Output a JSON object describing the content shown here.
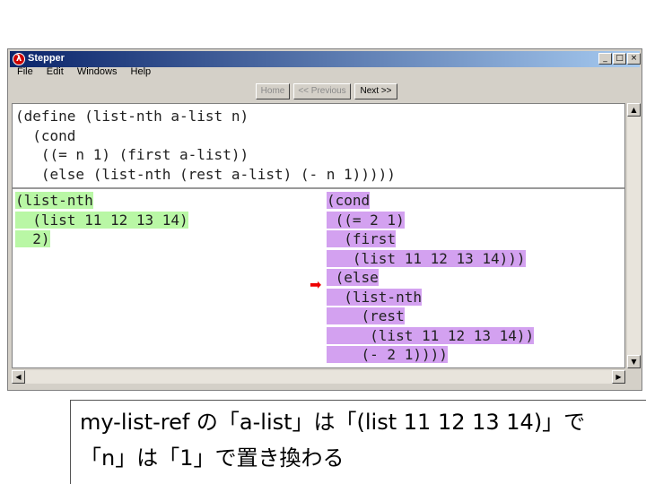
{
  "window": {
    "title": "Stepper",
    "controls": {
      "minimize": "_",
      "maximize": "□",
      "close": "×"
    }
  },
  "menubar": {
    "items": [
      "File",
      "Edit",
      "Windows",
      "Help"
    ]
  },
  "toolbar": {
    "home": "Home",
    "previous": "<< Previous",
    "next": "Next >>"
  },
  "definition": {
    "lines": [
      "(define (list-nth a-list n)",
      "  (cond",
      "   ((= n 1) (first a-list))",
      "   (else (list-nth (rest a-list) (- n 1)))))"
    ]
  },
  "before": {
    "lines": [
      "(list-nth",
      "  (list 11 12 13 14)",
      "  2)"
    ]
  },
  "after": {
    "lines": [
      "(cond",
      " ((= 2 1)",
      "  (first",
      "   (list 11 12 13 14)))",
      " (else",
      "  (list-nth",
      "    (rest",
      "     (list 11 12 13 14))",
      "    (- 2 1))))"
    ]
  },
  "caption": {
    "line1": "my-list-ref の「a-list」は「(list 11 12 13 14)」で",
    "line2": "「n」は「1」で置き換わる"
  },
  "colors": {
    "before_highlight": "#b9f7a5",
    "after_highlight": "#d3a1f0",
    "arrow": "#e00000"
  }
}
